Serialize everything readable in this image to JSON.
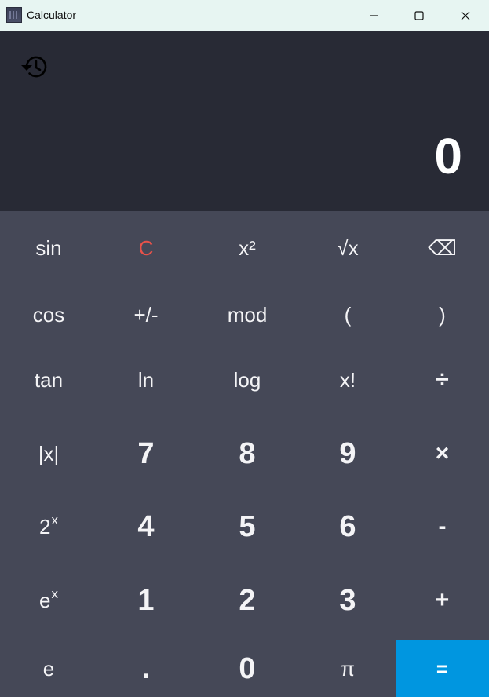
{
  "window": {
    "title": "Calculator"
  },
  "display": {
    "value": "0"
  },
  "icons": {
    "app": "calculator-app-icon",
    "history": "history-icon",
    "minimize": "minimize-icon",
    "maximize": "maximize-icon",
    "close": "close-icon"
  },
  "colors": {
    "titlebar": "#e7f5f2",
    "display_bg": "#282a35",
    "keypad_bg": "#454857",
    "clear": "#e8524a",
    "equals_bg": "#0096e0"
  },
  "keys": {
    "sin": "sin",
    "clear": "C",
    "square": "x²",
    "sqrt": "√x",
    "backspace": "⌫",
    "cos": "cos",
    "negate": "+/-",
    "mod": "mod",
    "open_paren": "(",
    "close_paren": ")",
    "tan": "tan",
    "ln": "ln",
    "log": "log",
    "factorial": "x!",
    "divide": "÷",
    "abs": "|x|",
    "seven": "7",
    "eight": "8",
    "nine": "9",
    "multiply": "×",
    "pow2_base": "2",
    "pow2_exp": "x",
    "four": "4",
    "five": "5",
    "six": "6",
    "minus": "-",
    "exp_base": "e",
    "exp_exp": "x",
    "one": "1",
    "two": "2",
    "three": "3",
    "plus": "+",
    "e": "e",
    "decimal": ".",
    "zero": "0",
    "pi": "π",
    "equals": "="
  }
}
